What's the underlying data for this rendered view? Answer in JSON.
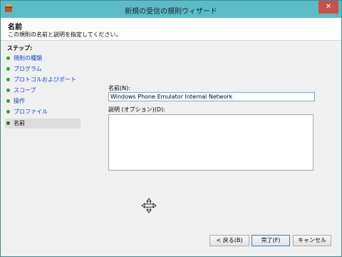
{
  "window": {
    "title": "新規の受信の規則ウィザード",
    "close_label": "✕"
  },
  "header": {
    "title": "名前",
    "description": "この規則の名前と説明を指定してください。"
  },
  "steps": {
    "label": "ステップ:",
    "items": [
      {
        "label": "規則の種類"
      },
      {
        "label": "プログラム"
      },
      {
        "label": "プロトコルおよびポート"
      },
      {
        "label": "スコープ"
      },
      {
        "label": "操作"
      },
      {
        "label": "プロファイル"
      },
      {
        "label": "名前",
        "current": true
      }
    ]
  },
  "form": {
    "name_label": "名前(N):",
    "name_value": "Windows Phone Emulator Internal Network",
    "description_label": "説明 (オプション)(D):",
    "description_value": ""
  },
  "buttons": {
    "back": "< 戻る(B)",
    "finish": "完了(F)",
    "cancel": "キャンセル"
  },
  "colors": {
    "titlebar": "#5cbcc6",
    "close": "#c7504b",
    "link": "#1548c9",
    "step_dot": "#2fa42a"
  }
}
